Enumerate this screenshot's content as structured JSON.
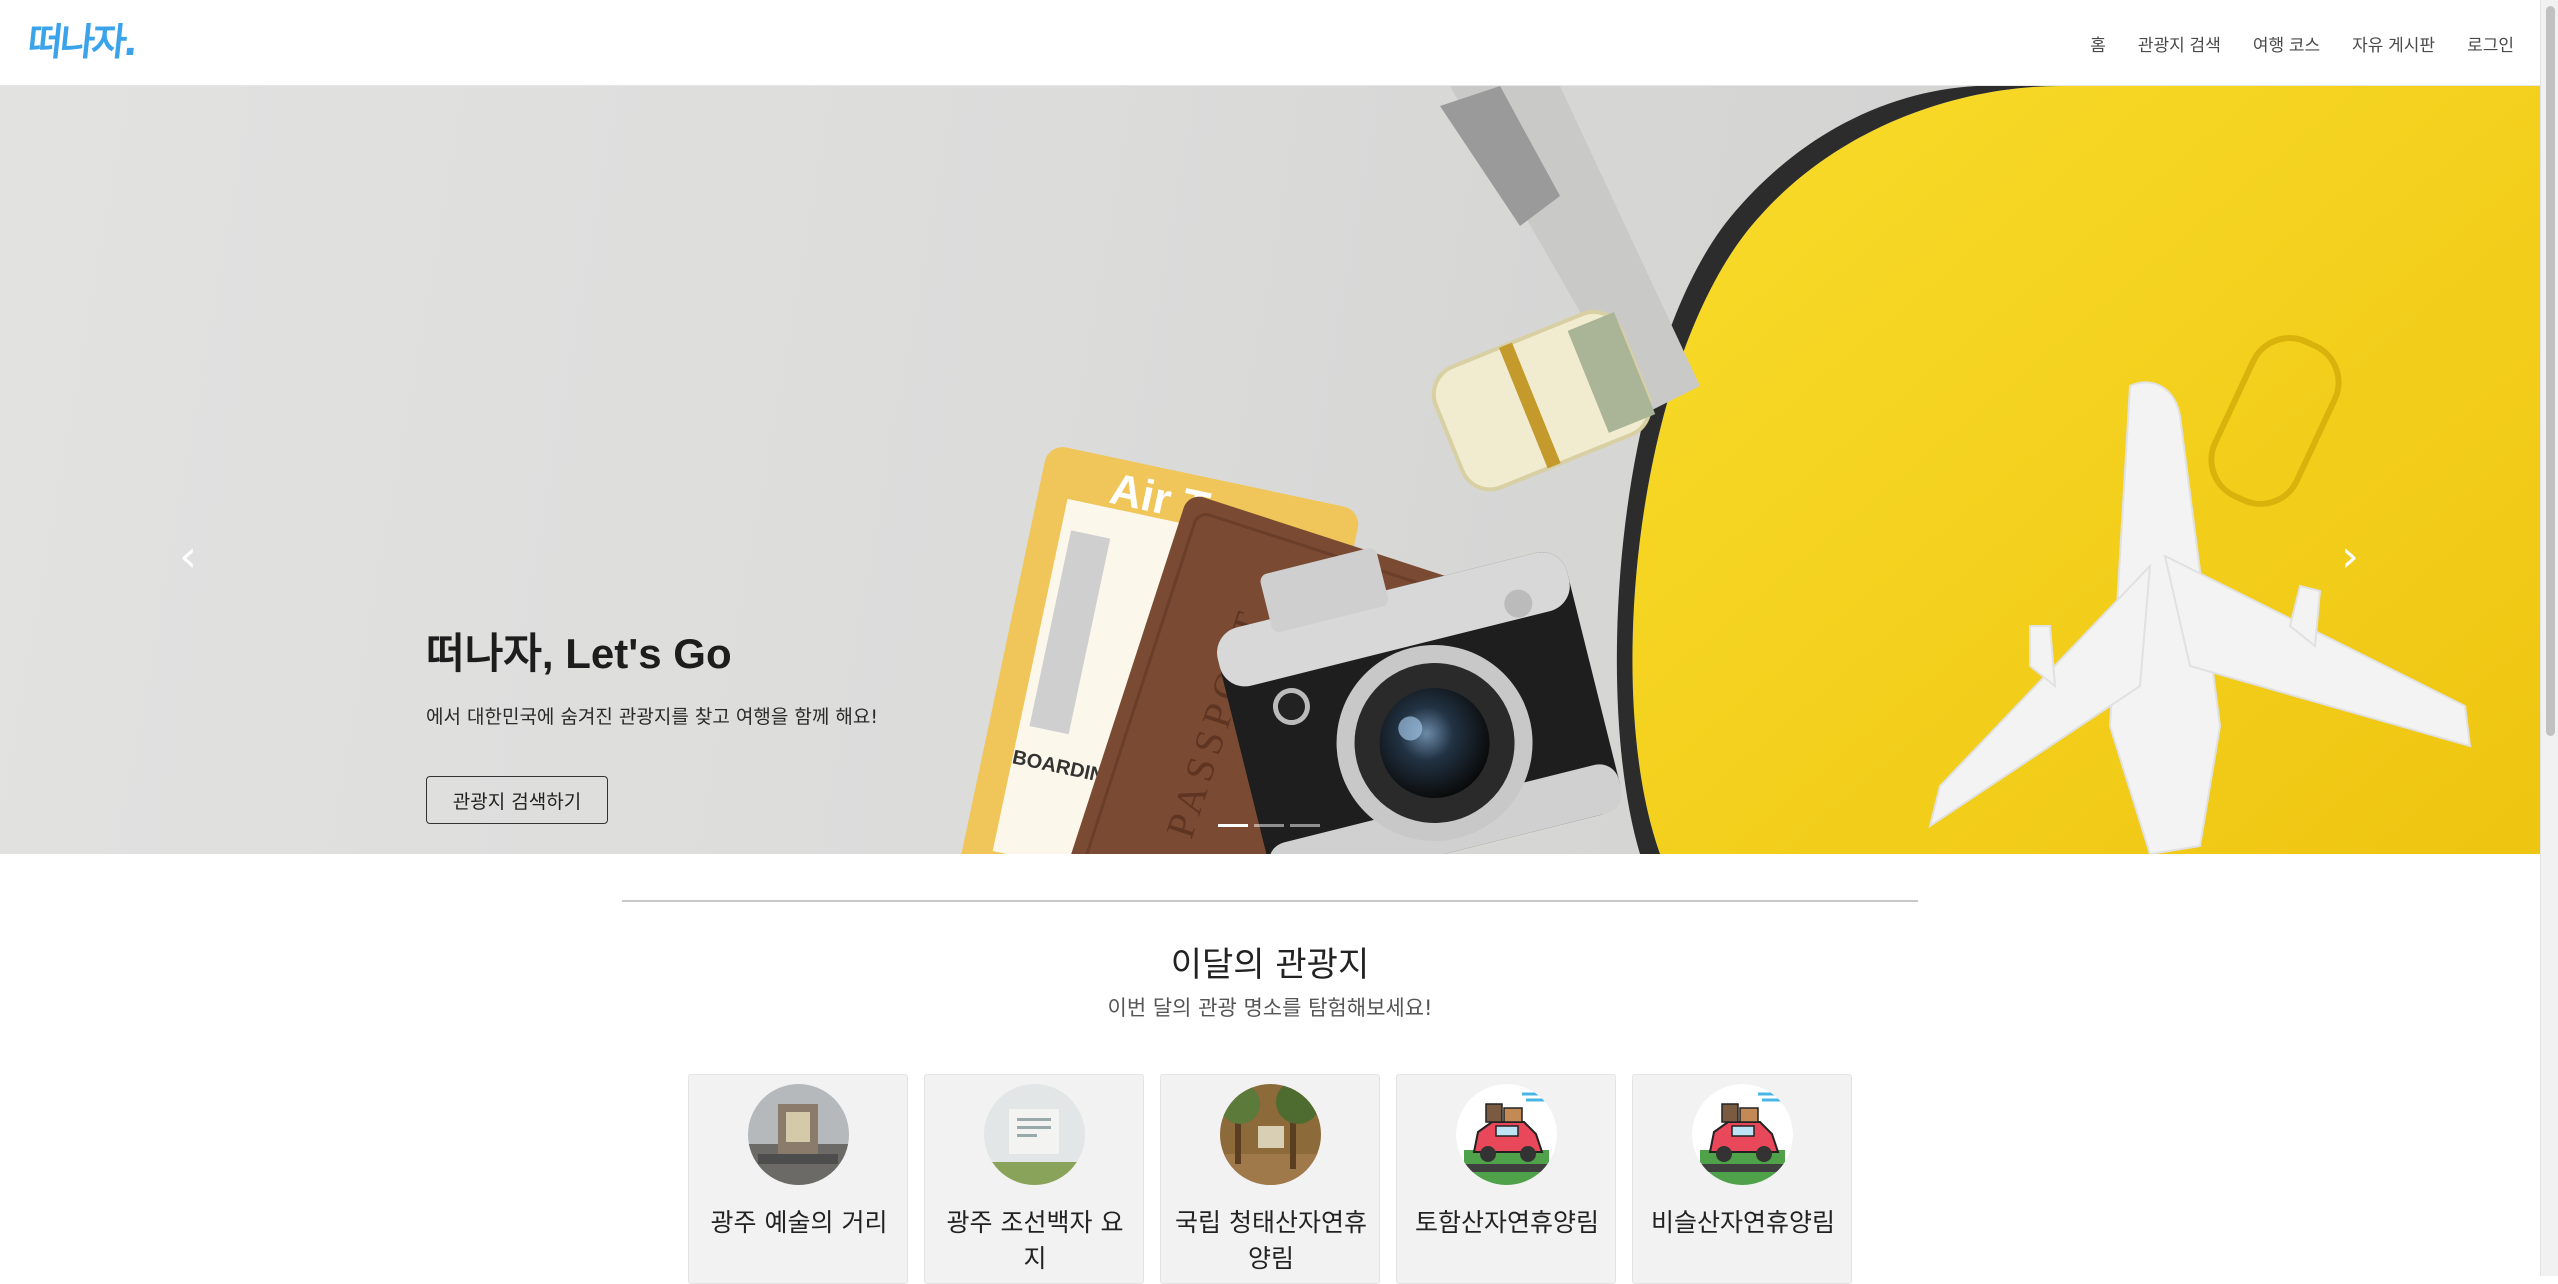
{
  "brand": {
    "name": "떠나자."
  },
  "nav": {
    "items": [
      {
        "label": "홈"
      },
      {
        "label": "관광지 검색"
      },
      {
        "label": "여행 코스"
      },
      {
        "label": "자유 게시판"
      },
      {
        "label": "로그인"
      }
    ]
  },
  "hero": {
    "title": "떠나자, Let's Go",
    "subtitle": "에서 대한민국에 숨겨진 관광지를 찾고 여행을 함께 해요!",
    "button_label": "관광지 검색하기",
    "prev_icon": "chevron-left-icon",
    "next_icon": "chevron-right-icon",
    "slide_count": 3,
    "active_slide": 1,
    "image_text": {
      "ticket": "Air T",
      "passport": "PASSPORT",
      "boarding": "BOARDING"
    }
  },
  "monthly": {
    "title": "이달의 관광지",
    "subtitle": "이번 달의 관광 명소를 탐험해보세요!",
    "cards": [
      {
        "title": "광주 예술의 거리",
        "image": "photo-art-street"
      },
      {
        "title": "광주 조선백자 요지",
        "image": "photo-porcelain-site"
      },
      {
        "title": "국립 청태산자연휴양림",
        "image": "photo-forest"
      },
      {
        "title": "토함산자연휴양림",
        "image": "car-travel-icon"
      },
      {
        "title": "비슬산자연휴양림",
        "image": "car-travel-icon"
      }
    ]
  },
  "colors": {
    "brand": "#3ba3ea",
    "suitcase": "#f5d21c",
    "passport": "#7b4a32"
  }
}
